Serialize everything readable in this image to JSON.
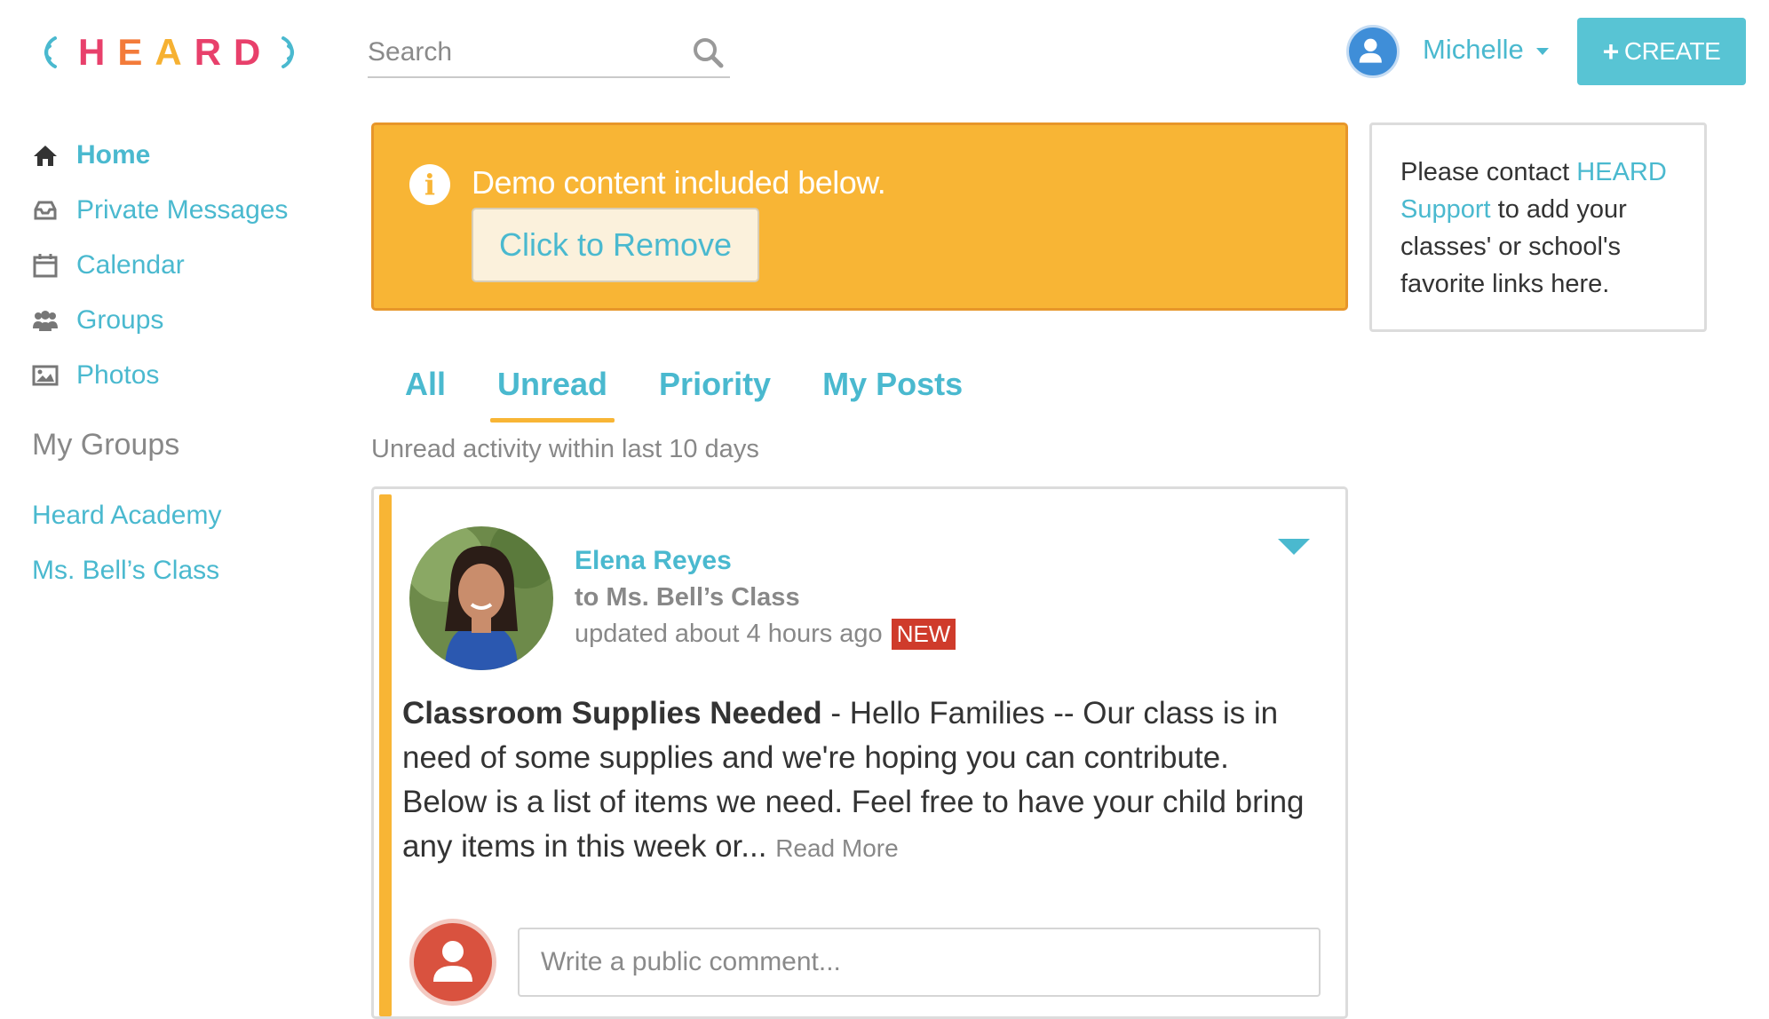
{
  "brand": {
    "logo_text": "HEARD",
    "colors": {
      "accent": "#4ab9cf",
      "banner": "#f8b535",
      "new_badge": "#cf3b2b",
      "create_button": "#58c4d4"
    }
  },
  "header": {
    "search_placeholder": "Search",
    "search_icon": "search-icon",
    "user_name": "Michelle",
    "create_label": "CREATE"
  },
  "sidebar": {
    "nav": [
      {
        "label": "Home",
        "icon": "home-icon",
        "active": true
      },
      {
        "label": "Private Messages",
        "icon": "inbox-icon"
      },
      {
        "label": "Calendar",
        "icon": "calendar-icon"
      },
      {
        "label": "Groups",
        "icon": "users-icon"
      },
      {
        "label": "Photos",
        "icon": "photo-icon"
      }
    ],
    "my_groups_heading": "My Groups",
    "groups": [
      "Heard Academy",
      "Ms. Bell’s Class"
    ]
  },
  "banner": {
    "message": "Demo content included below.",
    "remove_label": "Click to Remove"
  },
  "favorites": {
    "text_before": "Please contact ",
    "link_text": "HEARD Support",
    "text_after": " to add your classes' or school's favorite links here."
  },
  "feed": {
    "tabs": [
      "All",
      "Unread",
      "Priority",
      "My Posts"
    ],
    "active_tab": "Unread",
    "subtitle": "Unread activity within last 10 days",
    "post": {
      "author": "Elena Reyes",
      "to": "to Ms. Bell’s Class",
      "time": "updated about 4 hours ago",
      "badge": "NEW",
      "title": "Classroom Supplies Needed",
      "separator": " - ",
      "excerpt": "Hello Families -- Our class is in need of some supplies and we're hoping you can contribute. Below is a list of items we need. Feel free to have your child bring any items in this week or...",
      "read_more": "Read More",
      "comment_placeholder": "Write a public comment..."
    }
  }
}
